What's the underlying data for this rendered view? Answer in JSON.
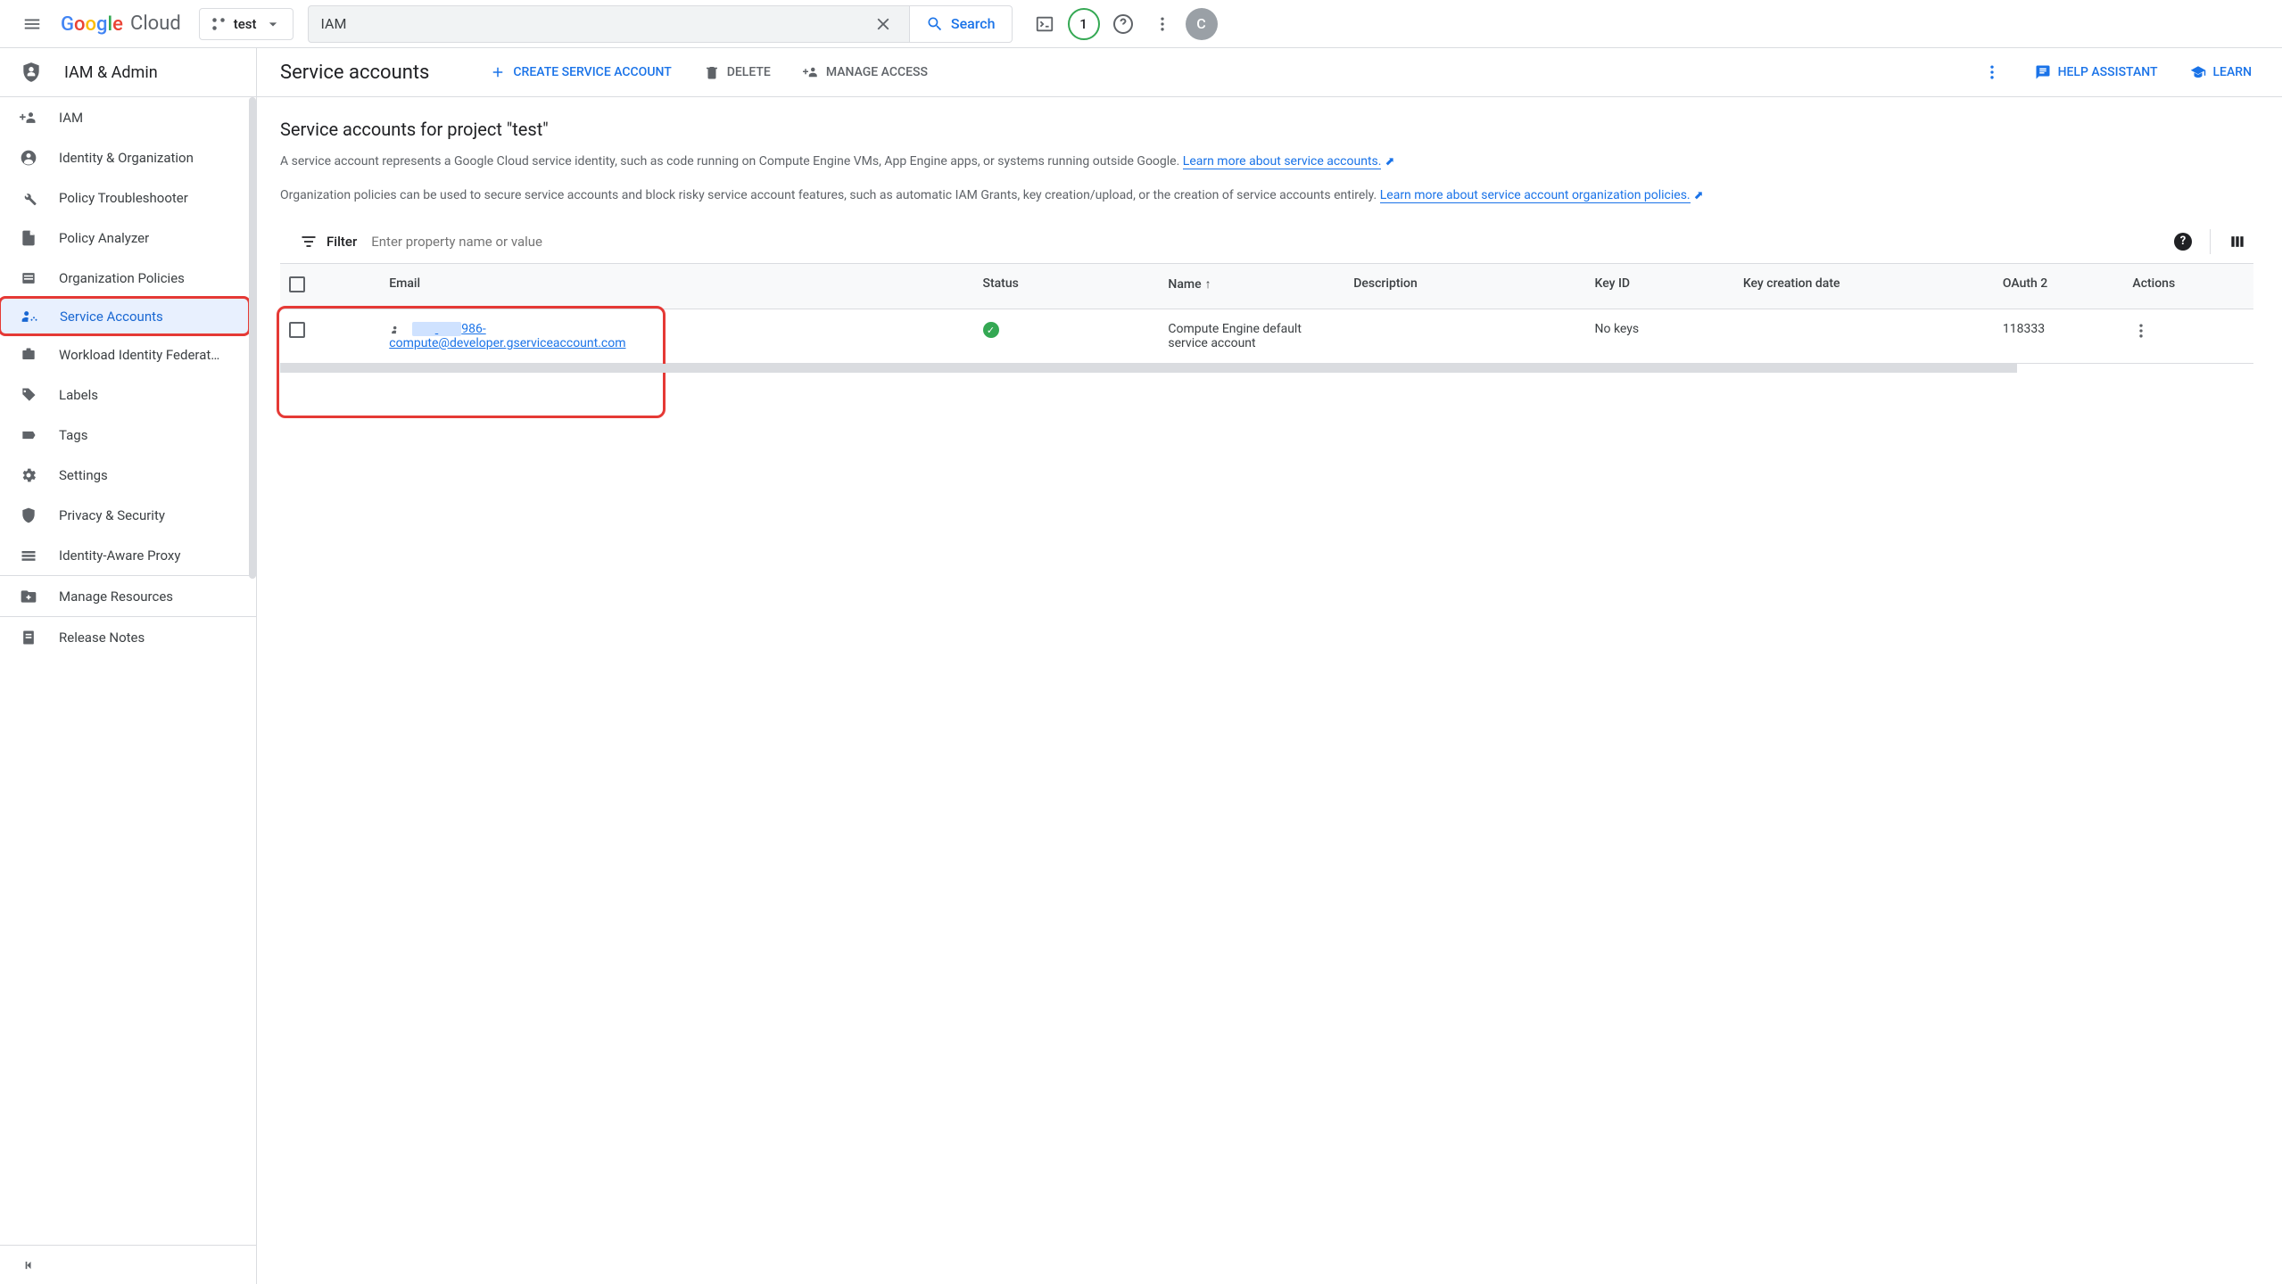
{
  "header": {
    "logo_cloud": "Cloud",
    "project_name": "test",
    "search_value": "IAM",
    "search_btn": "Search",
    "trial_count": "1",
    "avatar_initial": "C"
  },
  "sidebar": {
    "title": "IAM & Admin",
    "items": [
      {
        "label": "IAM"
      },
      {
        "label": "Identity & Organization"
      },
      {
        "label": "Policy Troubleshooter"
      },
      {
        "label": "Policy Analyzer"
      },
      {
        "label": "Organization Policies"
      },
      {
        "label": "Service Accounts"
      },
      {
        "label": "Workload Identity Federat…"
      },
      {
        "label": "Labels"
      },
      {
        "label": "Tags"
      },
      {
        "label": "Settings"
      },
      {
        "label": "Privacy & Security"
      },
      {
        "label": "Identity-Aware Proxy"
      }
    ],
    "lower": [
      {
        "label": "Manage Resources"
      },
      {
        "label": "Release Notes"
      }
    ]
  },
  "toolbar": {
    "page_title": "Service accounts",
    "create": "CREATE SERVICE ACCOUNT",
    "delete": "DELETE",
    "manage": "MANAGE ACCESS",
    "help": "HELP ASSISTANT",
    "learn": "LEARN"
  },
  "content": {
    "section_title": "Service accounts for project \"test\"",
    "desc1_a": "A service account represents a Google Cloud service identity, such as code running on Compute Engine VMs, App Engine apps, or systems running outside Google. ",
    "desc1_link": "Learn more about service accounts.",
    "desc2_a": "Organization policies can be used to secure service accounts and block risky service account features, such as automatic IAM Grants, key creation/upload, or the creation of service accounts entirely. ",
    "desc2_link": "Learn more about service account organization policies."
  },
  "filter": {
    "label": "Filter",
    "placeholder": "Enter property name or value"
  },
  "table": {
    "columns": [
      "Email",
      "Status",
      "Name",
      "Description",
      "Key ID",
      "Key creation date",
      "OAuth 2",
      "Actions"
    ],
    "rows": [
      {
        "email_prefix": "986-",
        "email_suffix": "compute@developer.gserviceaccount.com",
        "status": "ok",
        "name": "Compute Engine default service account",
        "description": "",
        "key_id": "No keys",
        "key_creation": "",
        "oauth2": "118333"
      }
    ]
  }
}
